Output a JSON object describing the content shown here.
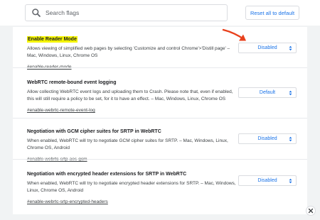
{
  "search": {
    "placeholder": "Search flags"
  },
  "toolbar": {
    "reset_label": "Reset all to default"
  },
  "flags": [
    {
      "title": "Enable Reader Mode",
      "description": "Allows viewing of simplified web pages by selecting 'Customize and control Chrome'>'Distill page' – Mac, Windows, Linux, Chrome OS",
      "link": "#enable-reader-mode",
      "value": "Disabled",
      "highlighted": true
    },
    {
      "title": "WebRTC remote-bound event logging",
      "description": "Allow collecting WebRTC event logs and uploading them to Crash. Please note that, even if enabled, this will still require a policy to be set, for it to have an effect. – Mac, Windows, Linux, Chrome OS",
      "link": "#enable-webrtc-remote-event-log",
      "value": "Default",
      "highlighted": false
    },
    {
      "title": "Negotiation with GCM cipher suites for SRTP in WebRTC",
      "description": "When enabled, WebRTC will try to negotiate GCM cipher suites for SRTP. – Mac, Windows, Linux, Chrome OS, Android",
      "link": "#enable-webrtc-srtp-aes-gcm",
      "value": "Disabled",
      "highlighted": false
    },
    {
      "title": "Negotiation with encrypted header extensions for SRTP in WebRTC",
      "description": "When enabled, WebRTC will try to negotiate encrypted header extensions for SRTP. – Mac, Windows, Linux, Chrome OS, Android",
      "link": "#enable-webrtc-srtp-encrypted-headers",
      "value": "Disabled",
      "highlighted": false
    }
  ],
  "colors": {
    "accent": "#1a73e8",
    "highlight": "#f4f400",
    "annotation_arrow": "#e8401c"
  },
  "icons": {
    "search": "search-icon",
    "select_arrows": "up-down-arrows-icon",
    "close": "close-icon",
    "annotation": "red-arrow-icon"
  }
}
